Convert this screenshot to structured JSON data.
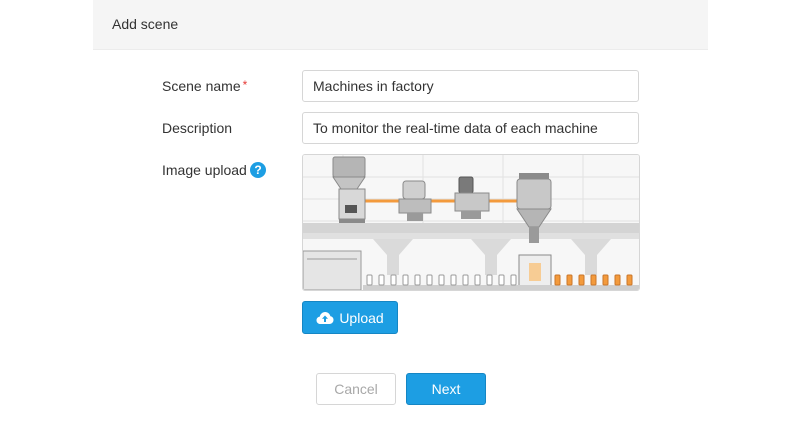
{
  "dialog": {
    "title": "Add scene"
  },
  "form": {
    "scene_name": {
      "label": "Scene name",
      "required_mark": "*",
      "value": "Machines in factory"
    },
    "description": {
      "label": "Description",
      "value": "To monitor the real-time data of each machine"
    },
    "image_upload": {
      "label": "Image upload",
      "help_icon": "question-circle-icon",
      "help_glyph": "?"
    }
  },
  "upload_button": {
    "label": "Upload",
    "icon": "cloud-upload-icon"
  },
  "actions": {
    "cancel_label": "Cancel",
    "next_label": "Next"
  },
  "colors": {
    "primary": "#1d9ee3",
    "required": "#e53935",
    "bottle": "#f39a3c"
  }
}
